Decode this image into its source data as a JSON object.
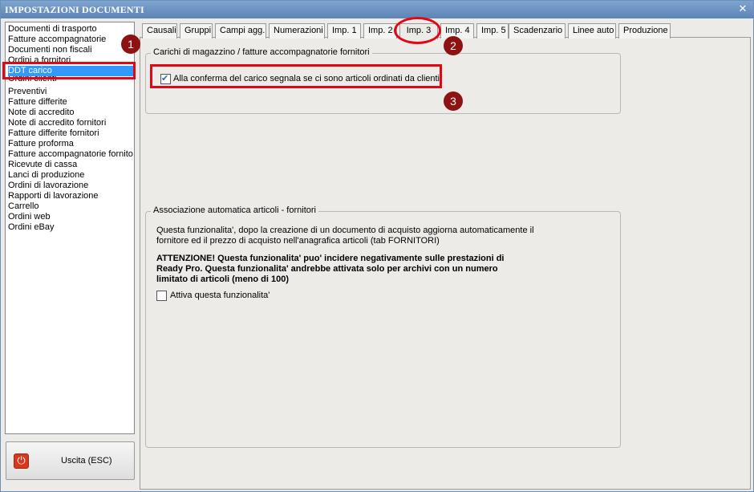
{
  "window": {
    "title": "IMPOSTAZIONI DOCUMENTI",
    "close_glyph": "✕"
  },
  "sidebar": {
    "items": [
      "Documenti di trasporto",
      "Fatture accompagnatorie",
      "Documenti non fiscali",
      "Ordini a fornitori",
      "DDT carico",
      "Ordini clienti",
      "Preventivi",
      "Fatture differite",
      "Note di accredito",
      "Note di accredito fornitori",
      "Fatture differite fornitori",
      "Fatture proforma",
      "Fatture accompagnatorie fornito",
      "Ricevute di cassa",
      "Lanci di produzione",
      "Ordini di lavorazione",
      "Rapporti di lavorazione",
      "Carrello",
      "Ordini web",
      "Ordini eBay"
    ],
    "selected": "DDT carico",
    "exit_label": "Uscita (ESC)",
    "exit_icon": "power-icon"
  },
  "tabs": [
    "Causali",
    "Gruppi",
    "Campi agg.",
    "Numerazioni",
    "Imp. 1",
    "Imp. 2",
    "Imp. 3",
    "Imp. 4",
    "Imp. 5",
    "Scadenzario",
    "Linee auto",
    "Produzione"
  ],
  "active_tab": "Imp. 3",
  "group1": {
    "title": "Carichi di magazzino / fatture accompagnatorie fornitori",
    "checkbox_label": "Alla conferma del carico segnala se ci sono articoli ordinati da clienti",
    "checked": true
  },
  "group2": {
    "title": "Associazione automatica articoli - fornitori",
    "desc_line1": "Questa funzionalita', dopo la creazione di un documento di acquisto aggiorna automaticamente il",
    "desc_line2": "fornitore ed il prezzo di acquisto nell'anagrafica articoli (tab FORNITORI)",
    "warn_line1": "ATTENZIONE! Questa funzionalita' puo' incidere negativamente sulle prestazioni di",
    "warn_line2": "Ready Pro. Questa funzionalita' andrebbe attivata solo per archivi con un numero",
    "warn_line3": "limitato di articoli (meno di 100)",
    "checkbox_label": "Attiva questa funzionalita'",
    "checked": false
  },
  "markers": [
    "1",
    "2",
    "3"
  ],
  "colors": {
    "highlight": "#e30613",
    "marker": "#8e1212",
    "selection": "#3399ff"
  }
}
